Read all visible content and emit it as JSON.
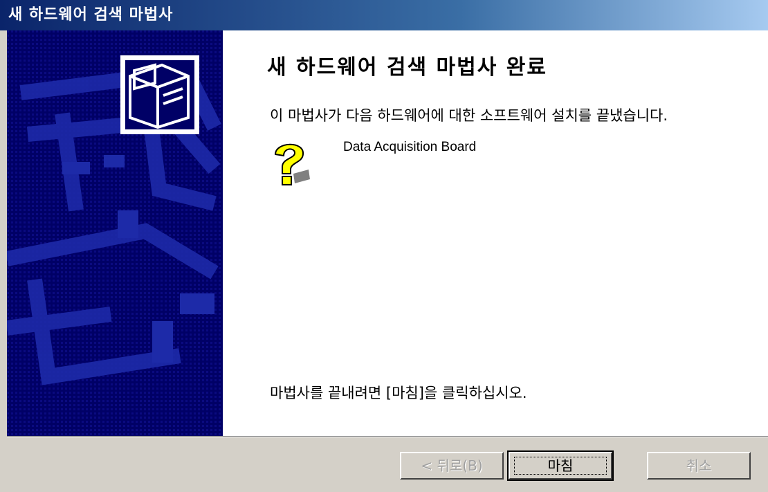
{
  "window": {
    "title": "새 하드웨어 검색 마법사"
  },
  "main": {
    "heading": "새 하드웨어 검색 마법사 완료",
    "description": "이 마법사가 다음 하드웨어에 대한 소프트웨어 설치를 끝냈습니다.",
    "device_name": "Data Acquisition Board",
    "device_icon": "unknown-device-question-icon",
    "finish_note": "마법사를 끝내려면 [마침]을 클릭하십시오."
  },
  "buttons": {
    "back_label": "< 뒤로(B)",
    "finish_label": "마침",
    "cancel_label": "취소"
  },
  "colors": {
    "banner": "#000066",
    "titlebar_start": "#0a246a",
    "titlebar_end": "#a6caf0",
    "face": "#d4d0c8"
  }
}
